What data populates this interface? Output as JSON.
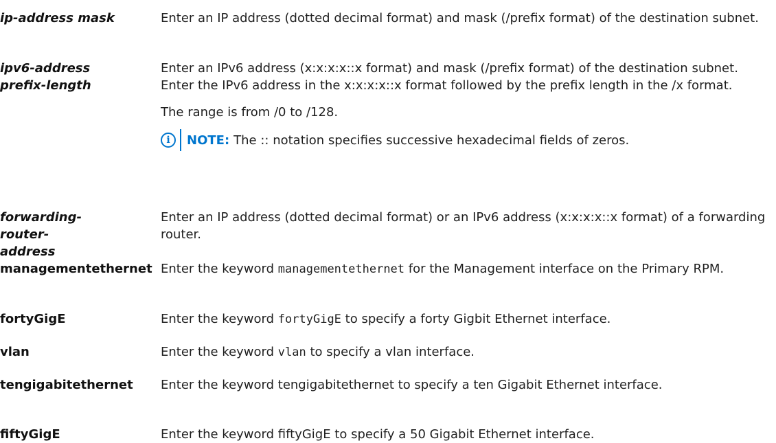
{
  "rows": [
    {
      "term": "ip-address mask",
      "desc": "Enter an IP address (dotted decimal format) and mask (/prefix format) of the destination subnet."
    },
    {
      "term": "ipv6-address prefix-length",
      "desc": "Enter an IPv6 address (x:x:x:x::x format) and mask (/prefix format) of the destination subnet. Enter the IPv6 address in the x:x:x:x::x format followed by the prefix length in the /x format.",
      "desc2": "The range is from /0 to /128.",
      "note_label": "NOTE:",
      "note_text": "The :: notation specifies successive hexadecimal fields of zeros.",
      "note_icon": "info-icon"
    },
    {
      "term": "forwarding-router-address",
      "desc": "Enter an IP address (dotted decimal format) or an IPv6 address (x:x:x:x::x format) of a forwarding router."
    },
    {
      "term": "managementethernet",
      "desc_pre": "Enter the keyword",
      "keyword": "managementethernet",
      "desc_post": "for the Management interface on the Primary RPM."
    },
    {
      "term": "fortyGigE",
      "desc_pre": "Enter the keyword",
      "keyword": "fortyGigE",
      "desc_post": "to specify a forty Gigbit Ethernet interface."
    },
    {
      "term": "vlan",
      "desc_pre": "Enter the keyword",
      "keyword": "vlan",
      "desc_post": "to specify a vlan interface."
    },
    {
      "term": "tengigabitethernet",
      "desc": "Enter the keyword tengigabitethernet to specify a ten Gigabit Ethernet interface."
    },
    {
      "term": "fiftyGigE",
      "desc": "Enter the keyword fiftyGigE to specify a 50 Gigabit Ethernet interface."
    }
  ]
}
